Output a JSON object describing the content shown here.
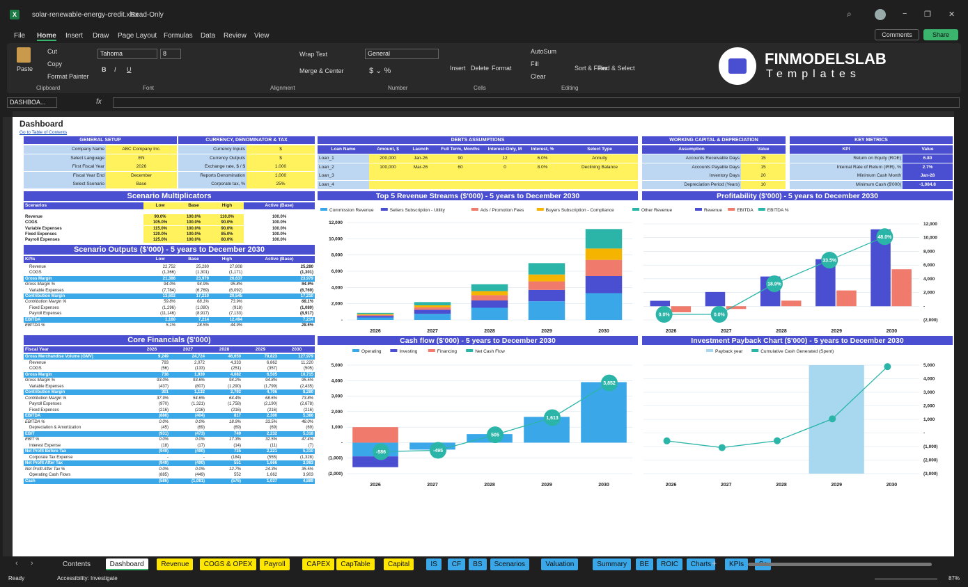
{
  "window": {
    "filename": "solar-renewable-energy-credit.xlsx",
    "mode": "Read-Only",
    "minimize": "−",
    "restore": "❐",
    "close": "✕"
  },
  "menu": [
    "File",
    "Home",
    "Insert",
    "Draw",
    "Page Layout",
    "Formulas",
    "Data",
    "Review",
    "View"
  ],
  "ribbon": {
    "comments": "Comments",
    "share": "Share",
    "paste": "Paste",
    "cut": "Cut",
    "copy": "Copy",
    "format_painter": "Format Painter",
    "clipboard": "Clipboard",
    "font_name": "Tahoma",
    "font_size": "8",
    "font": "Font",
    "wrap_text": "Wrap Text",
    "merge_center": "Merge & Center",
    "alignment": "Alignment",
    "number_format": "General",
    "number": "Number",
    "insert": "Insert",
    "delete": "Delete",
    "format": "Format",
    "cells": "Cells",
    "autosum": "AutoSum",
    "fill": "Fill",
    "clear": "Clear",
    "sort_filter": "Sort & Filter",
    "find_select": "Find & Select",
    "editing": "Editing",
    "brand1": "FINMODELSLAB",
    "brand2": "Templates"
  },
  "formula_bar": {
    "name_box": "DASHBOA...",
    "fx": "fx"
  },
  "dashboard": {
    "title": "Dashboard",
    "toc_link": "Go to Table of Contents"
  },
  "general_setup": {
    "title": "GENERAL SETUP",
    "rows": [
      [
        "Company Name",
        "ABC Company Inc."
      ],
      [
        "Select Language",
        "EN"
      ],
      [
        "First Fiscal Year",
        "2026"
      ],
      [
        "Fiscal Year End",
        "December"
      ],
      [
        "Select Scenario",
        "Base"
      ]
    ]
  },
  "currency": {
    "title": "CURRENCY, DENOMINATOR & TAX",
    "rows": [
      [
        "Currency Inputs",
        "$"
      ],
      [
        "Currency Outputs",
        "$"
      ],
      [
        "Exchange rate, $ / $",
        "1.000"
      ],
      [
        "Reports Denomination",
        "1,000"
      ],
      [
        "Corporate tax, %",
        "25%"
      ]
    ]
  },
  "debts": {
    "title": "DEBTS ASSUMPTIONS",
    "headers": [
      "Loan Name",
      "Amount, $",
      "Launch",
      "Full Term, Months",
      "Interest-Only, M",
      "Interest, %",
      "Select Type"
    ],
    "rows": [
      [
        "Loan_1",
        "200,000",
        "Jan-26",
        "90",
        "12",
        "6.0%",
        "Annuity"
      ],
      [
        "Loan_2",
        "100,000",
        "Mar-26",
        "60",
        "0",
        "8.0%",
        "Declining Balance"
      ],
      [
        "Loan_3",
        "",
        "",
        "",
        "",
        "",
        ""
      ],
      [
        "Loan_4",
        "",
        "",
        "",
        "",
        "",
        ""
      ]
    ]
  },
  "working_capital": {
    "title": "WORKING CAPITAL & DEPRECIATION",
    "headers": [
      "Assumption",
      "Value"
    ],
    "rows": [
      [
        "Accounts Receivable Days",
        "15"
      ],
      [
        "Accounts Payable Days",
        "15"
      ],
      [
        "Inventory Days",
        "20"
      ],
      [
        "Depreciation Period (Years)",
        "10"
      ]
    ]
  },
  "key_metrics": {
    "title": "KEY METRICS",
    "headers": [
      "KPI",
      "Value"
    ],
    "rows": [
      [
        "Return on Equity (ROE)",
        "6.80"
      ],
      [
        "Internal Rate of Return (IRR), %",
        "2.7%"
      ],
      [
        "Minimum Cash Month",
        "Jan-28"
      ],
      [
        "Minimum Cash ($'000)",
        "-1,084.8"
      ]
    ]
  },
  "scenario_mult": {
    "title": "Scenario Multiplicators",
    "headers": [
      "Scenarios",
      "Low",
      "Base",
      "High",
      "Active (Base)"
    ],
    "rows": [
      [
        "Revenue",
        "90.0%",
        "100.0%",
        "110.0%",
        "100.0%"
      ],
      [
        "COGS",
        "105.0%",
        "100.0%",
        "90.0%",
        "100.0%"
      ],
      [
        "Variable Expenses",
        "115.0%",
        "100.0%",
        "90.0%",
        "100.0%"
      ],
      [
        "Fixed Expenses",
        "120.0%",
        "100.0%",
        "85.0%",
        "100.0%"
      ],
      [
        "Payroll Expenses",
        "125.0%",
        "100.0%",
        "80.0%",
        "100.0%"
      ]
    ]
  },
  "scenario_out": {
    "title": "Scenario Outputs ($'000) - 5 years to December 2030",
    "headers": [
      "KPIs",
      "Low",
      "Base",
      "High",
      "Active (Base)"
    ],
    "rows": [
      [
        "Revenue",
        "22,752",
        "25,280",
        "27,808",
        "25,280",
        ""
      ],
      [
        "COGS",
        "(1,366)",
        "(1,301)",
        "(1,171)",
        "(1,301)",
        ""
      ],
      [
        "Gross Margin",
        "21,386",
        "23,979",
        "26,637",
        "23,979",
        "h"
      ],
      [
        "Gross Margin %",
        "94.0%",
        "94.9%",
        "95.8%",
        "94.9%",
        "i"
      ],
      [
        "Variable Expenses",
        "(7,784)",
        "(6,769)",
        "(6,092)",
        "(6,769)",
        ""
      ],
      [
        "Contribution Margin",
        "13,602",
        "17,210",
        "20,545",
        "17,210",
        "h"
      ],
      [
        "Contribution Margin %",
        "59.8%",
        "68.1%",
        "73.9%",
        "68.1%",
        "i"
      ],
      [
        "Fixed Expenses",
        "(1,296)",
        "(1,080)",
        "(918)",
        "(1,080)",
        ""
      ],
      [
        "Payroll Expenses",
        "(11,146)",
        "(8,917)",
        "(7,133)",
        "(8,917)",
        ""
      ],
      [
        "EBITDA",
        "1,160",
        "7,214",
        "12,494",
        "7,214",
        "h"
      ],
      [
        "EBITDA %",
        "5.1%",
        "28.5%",
        "44.9%",
        "28.5%",
        "i"
      ]
    ]
  },
  "core": {
    "title": "Core Financials ($'000)",
    "headers": [
      "Fiscal Year",
      "2026",
      "2027",
      "2028",
      "2029",
      "2030"
    ],
    "rows": [
      [
        "Gross Merchandise Volume (GMV)",
        "9,249",
        "24,724",
        "46,650",
        "79,823",
        "127,979",
        "h"
      ],
      [
        "Revenue",
        "793",
        "2,072",
        "4,333",
        "6,862",
        "11,220",
        ""
      ],
      [
        "COGS",
        "(56)",
        "(133)",
        "(251)",
        "(357)",
        "(505)",
        ""
      ],
      [
        "Gross Margin",
        "738",
        "1,939",
        "4,082",
        "6,505",
        "10,715",
        "h"
      ],
      [
        "Gross Margin %",
        "93.0%",
        "93.6%",
        "94.2%",
        "94.8%",
        "95.5%",
        "i"
      ],
      [
        "Variable Expenses",
        "(437)",
        "(807)",
        "(1,290)",
        "(1,799)",
        "(2,435)",
        ""
      ],
      [
        "Contribution Margin",
        "301",
        "1,132",
        "2,792",
        "4,706",
        "8,280",
        "h"
      ],
      [
        "Contribution Margin %",
        "37.9%",
        "54.6%",
        "64.4%",
        "68.6%",
        "73.8%",
        "i"
      ],
      [
        "Payroll Expenses",
        "(970)",
        "(1,321)",
        "(1,758)",
        "(2,190)",
        "(2,678)",
        ""
      ],
      [
        "Fixed Expenses",
        "(216)",
        "(216)",
        "(216)",
        "(216)",
        "(216)",
        ""
      ],
      [
        "EBITDA",
        "(886)",
        "(404)",
        "817",
        "2,300",
        "5,386",
        "h"
      ],
      [
        "EBITDA %",
        "0.0%",
        "0.0%",
        "18.9%",
        "33.5%",
        "48.0%",
        "i"
      ],
      [
        "Depreciation & Amortization",
        "(45)",
        "(69)",
        "(69)",
        "(69)",
        "(69)",
        ""
      ],
      [
        "EBIT",
        "(931)",
        "(473)",
        "749",
        "2,232",
        "5,318",
        "h"
      ],
      [
        "EBIT %",
        "0.0%",
        "0.0%",
        "17.3%",
        "32.5%",
        "47.4%",
        "i"
      ],
      [
        "Interest Expense",
        "(18)",
        "(17)",
        "(14)",
        "(11)",
        "(7)",
        ""
      ],
      [
        "Net Profit Before Tax",
        "(949)",
        "(490)",
        "735",
        "2,221",
        "5,310",
        "h"
      ],
      [
        "Corporate Tax Expense",
        "-",
        "-",
        "(184)",
        "(555)",
        "(1,328)",
        ""
      ],
      [
        "Net Profit After Tax",
        "(949)",
        "(490)",
        "551",
        "1,666",
        "3,983",
        "h"
      ],
      [
        "Net Profit After Tax %",
        "0.0%",
        "0.0%",
        "12.7%",
        "24.3%",
        "35.5%",
        "i"
      ],
      [
        "Operating Cash Flows",
        "(885)",
        "(449)",
        "552",
        "1,662",
        "3,903",
        ""
      ],
      [
        "Cash",
        "(586)",
        "(1,081)",
        "(576)",
        "1,037",
        "4,889",
        "h"
      ]
    ]
  },
  "chart_data": [
    {
      "type": "bar",
      "title": "Top 5 Revenue Streams ($'000) - 5 years to December 2030",
      "categories": [
        "2026",
        "2027",
        "2028",
        "2029",
        "2030"
      ],
      "ylim": [
        0,
        12000
      ],
      "yticks": [
        "12,000",
        "10,000",
        "8,000",
        "6,000",
        "4,000",
        "2,000",
        "-"
      ],
      "series": [
        {
          "name": "Commission Revenue",
          "color": "#3aa8e8",
          "values": [
            300,
            750,
            1500,
            2300,
            3300
          ]
        },
        {
          "name": "Sellers Subscription - Utility",
          "color": "#4a4fd1",
          "values": [
            200,
            500,
            900,
            1400,
            2100
          ]
        },
        {
          "name": "Ads / Promotion Fees",
          "color": "#f07b6c",
          "values": [
            120,
            300,
            650,
            1050,
            2000
          ]
        },
        {
          "name": "Buyers Subscription - Compliance",
          "color": "#f5b400",
          "values": [
            100,
            250,
            500,
            850,
            1400
          ]
        },
        {
          "name": "Other Revenue",
          "color": "#2bb5a8",
          "values": [
            150,
            400,
            850,
            1400,
            2400
          ]
        }
      ]
    },
    {
      "type": "bar",
      "title": "Profitability ($'000) - 5 years to December 2030",
      "categories": [
        "2026",
        "2027",
        "2028",
        "2029",
        "2030"
      ],
      "ylim": [
        -2000,
        12000
      ],
      "yticks": [
        "12,000",
        "10,000",
        "8,000",
        "6,000",
        "4,000",
        "2,000",
        "-",
        "(2,000)"
      ],
      "series": [
        {
          "name": "Revenue",
          "color": "#4a4fd1",
          "values": [
            793,
            2072,
            4333,
            6862,
            11220
          ]
        },
        {
          "name": "EBITDA",
          "color": "#f07b6c",
          "values": [
            -886,
            -404,
            817,
            2300,
            5386
          ]
        },
        {
          "name": "EBITDA %",
          "color": "#2bb5a8",
          "values": [
            0,
            0,
            18.9,
            33.5,
            48.0
          ],
          "labels": [
            "0.0%",
            "0.0%",
            "18.9%",
            "33.5%",
            "48.0%"
          ]
        }
      ]
    },
    {
      "type": "bar",
      "title": "Cash flow ($'000) - 5 years to December 2030",
      "categories": [
        "2026",
        "2027",
        "2028",
        "2029",
        "2030"
      ],
      "ylim": [
        -2000,
        5000
      ],
      "yticks": [
        "5,000",
        "4,000",
        "3,000",
        "2,000",
        "1,000",
        "-",
        "(1,000)",
        "(2,000)"
      ],
      "series": [
        {
          "name": "Operating",
          "color": "#3aa8e8",
          "values": [
            -885,
            -449,
            552,
            1662,
            3903
          ]
        },
        {
          "name": "Investing",
          "color": "#4a4fd1",
          "values": [
            -700,
            0,
            0,
            0,
            0
          ]
        },
        {
          "name": "Financing",
          "color": "#f07b6c",
          "values": [
            1000,
            0,
            0,
            0,
            0
          ]
        },
        {
          "name": "Net Cash Flow",
          "color": "#2bb5a8",
          "values": [
            -586,
            -495,
            505,
            1613,
            3852
          ],
          "labels": [
            "-586",
            "-495",
            "505",
            "1,613",
            "3,852"
          ]
        }
      ]
    },
    {
      "type": "line",
      "title": "Investment Payback Chart ($'000) - 5 years to December 2030",
      "categories": [
        "2026",
        "2027",
        "2028",
        "2029",
        "2030"
      ],
      "ylim": [
        -3000,
        5000
      ],
      "yticks": [
        "5,000",
        "4,000",
        "3,000",
        "2,000",
        "1,000",
        "-",
        "(1,000)",
        "(2,000)",
        "(3,000)"
      ],
      "payback_year": "2029",
      "series": [
        {
          "name": "Payback year",
          "color": "#a8d8f0"
        },
        {
          "name": "Cumulative Cash Generated (Spent)",
          "color": "#2bb5a8",
          "values": [
            -586,
            -1081,
            -576,
            1037,
            4889
          ]
        }
      ]
    }
  ],
  "sheet_tabs": [
    {
      "n": "Contents",
      "c": "none"
    },
    {
      "n": "Dashboard",
      "c": "active"
    },
    {
      "n": "Revenue",
      "c": "#ffe600"
    },
    {
      "n": "COGS & OPEX",
      "c": "#ffe600"
    },
    {
      "n": "Payroll",
      "c": "#ffe600"
    },
    {
      "n": "CAPEX",
      "c": "#ffe600"
    },
    {
      "n": "CapTable",
      "c": "#ffe600"
    },
    {
      "n": "Capital",
      "c": "#ffe600"
    },
    {
      "n": "IS",
      "c": "#3aa8e8"
    },
    {
      "n": "CF",
      "c": "#3aa8e8"
    },
    {
      "n": "BS",
      "c": "#3aa8e8"
    },
    {
      "n": "Scenarios",
      "c": "#3aa8e8"
    },
    {
      "n": "Valuation",
      "c": "#3aa8e8"
    },
    {
      "n": "Summary",
      "c": "#3aa8e8"
    },
    {
      "n": "BE",
      "c": "#3aa8e8"
    },
    {
      "n": "ROIC",
      "c": "#3aa8e8"
    },
    {
      "n": "Charts",
      "c": "#3aa8e8"
    },
    {
      "n": "KPIs",
      "c": "#3aa8e8"
    },
    {
      "n": "Sc",
      "c": "#3aa8e8"
    }
  ],
  "status": {
    "ready": "Ready",
    "accessibility": "Accessibility: Investigate",
    "zoom": "87%"
  }
}
